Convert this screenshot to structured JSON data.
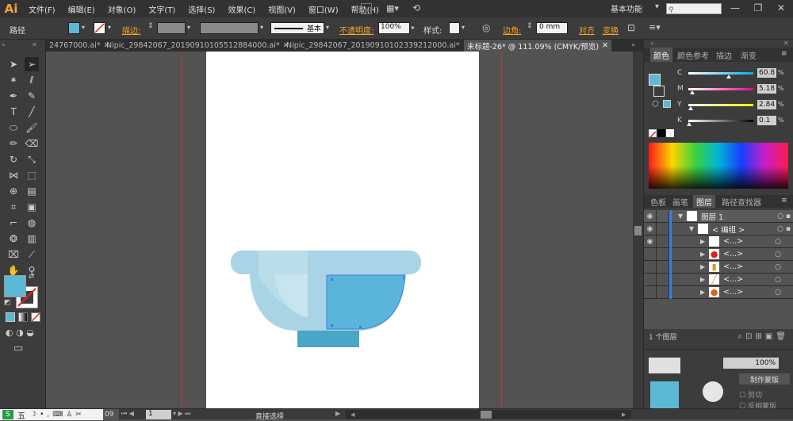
{
  "app": {
    "logo": "Ai"
  },
  "menus": [
    "文件(F)",
    "编辑(E)",
    "对象(O)",
    "文字(T)",
    "选择(S)",
    "效果(C)",
    "视图(V)",
    "窗口(W)",
    "帮助(H)"
  ],
  "workspace": "基本功能",
  "control": {
    "selection_type": "路径",
    "stroke_label": "描边:",
    "basic_label": "基本",
    "opacity_label": "不透明度:",
    "opacity_value": "100%",
    "style_label": "样式:",
    "corner_label": "边角:",
    "corner_value": "0 mm",
    "align_label": "对齐",
    "transform_label": "变换"
  },
  "tabs": [
    {
      "label": "24767000.ai*"
    },
    {
      "label": "Nipic_29842067_20190910105512884000.ai*"
    },
    {
      "label": "Nipic_29842067_20190910102339212000.ai*"
    },
    {
      "label": "未标题-26* @ 111.09% (CMYK/预览)"
    }
  ],
  "color_panel": {
    "tabs": [
      "颜色",
      "颜色参考",
      "描边",
      "渐变"
    ],
    "channels": [
      {
        "label": "C",
        "value": "60.8",
        "fraction": 0.608
      },
      {
        "label": "M",
        "value": "5.18",
        "fraction": 0.0518
      },
      {
        "label": "Y",
        "value": "2.84",
        "fraction": 0.0284
      },
      {
        "label": "K",
        "value": "0.1",
        "fraction": 0.001
      }
    ],
    "fill_color": "#5db8d6"
  },
  "layers_panel": {
    "tabs": [
      "色板",
      "画笔",
      "图层",
      "路径查找器"
    ],
    "rows": [
      {
        "label": "图层 1"
      },
      {
        "label": "< 编组 >"
      },
      {
        "label": "<...>"
      },
      {
        "label": "<...>"
      },
      {
        "label": "<...>"
      },
      {
        "label": "<...>"
      },
      {
        "label": "<...>"
      }
    ],
    "count": "1 个图层"
  },
  "bottom_panel": {
    "label": "制作蒙版",
    "opt1": "剪切",
    "opt2": "反相蒙版"
  },
  "status": {
    "zoom": "09",
    "page": "1",
    "tool": "直接选择"
  },
  "taskbar": {
    "ime": "五"
  },
  "colors": {
    "accent": "#f5a623",
    "bowl_light": "#a8d4e6",
    "bowl_mid": "#b9dde9",
    "bowl_dark": "#5bb4d9",
    "bowl_base": "#49a6c6",
    "guide": "#c0392b"
  }
}
